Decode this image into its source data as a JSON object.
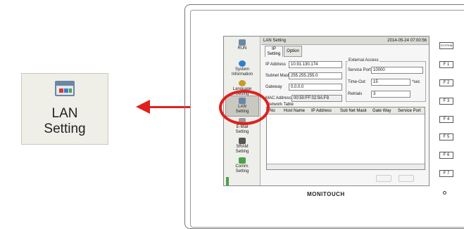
{
  "zoom": {
    "label": "LAN\nSetting"
  },
  "screen": {
    "title": "LAN Setting",
    "timestamp": "2014-05-24 07:00:56",
    "sidebar": [
      {
        "label": "RUN",
        "icon": "monitor-icon",
        "color": "#6c87a6"
      },
      {
        "label": "System\nInformation",
        "icon": "info-icon",
        "color": "#2f7ed0"
      },
      {
        "label": "Language\nSetting",
        "icon": "globe-icon",
        "color": "#c79a2a"
      },
      {
        "label": "LAN\nSetting",
        "icon": "lan-icon",
        "color": "#6c87a6"
      },
      {
        "label": "E-Mail\nSetting",
        "icon": "mail-icon",
        "color": "#999999"
      },
      {
        "label": "SRAM\nSetting",
        "icon": "sram-icon",
        "color": "#555555"
      },
      {
        "label": "Comm.\nSetting",
        "icon": "comm-icon",
        "color": "#4aa34a"
      }
    ],
    "tabs": {
      "ip": "IP\nSetting",
      "option": "Option"
    },
    "ip_address": {
      "label": "IP Address",
      "value": "10.91.130.174"
    },
    "subnet": {
      "label": "Subnet Mask",
      "value": "255.255.255.0"
    },
    "gateway": {
      "label": "Gateway",
      "value": "0.0.0.0"
    },
    "mac": {
      "label": "MAC Address",
      "value": "00:50:FF:02:9A:F8"
    },
    "external": {
      "title": "External Access",
      "service_port_label": "Service Port",
      "service_port": "10000",
      "timeout_label": "Time-Out",
      "timeout": "15",
      "timeout_unit": "*sec",
      "retrials_label": "Retrials",
      "retrials": "3"
    },
    "network_table": {
      "title": "Network Table",
      "columns": [
        "No",
        "Host Name",
        "IP Address",
        "Sub Net Mask",
        "Gate Way",
        "Service Port"
      ]
    }
  },
  "device": {
    "brand": "MONITOUCH",
    "fkeys": [
      "SYSTEM",
      "F 1",
      "F 2",
      "F 3",
      "F 4",
      "F 5",
      "F 6",
      "F 7"
    ]
  },
  "colors": {
    "accent": "#e0201e"
  }
}
